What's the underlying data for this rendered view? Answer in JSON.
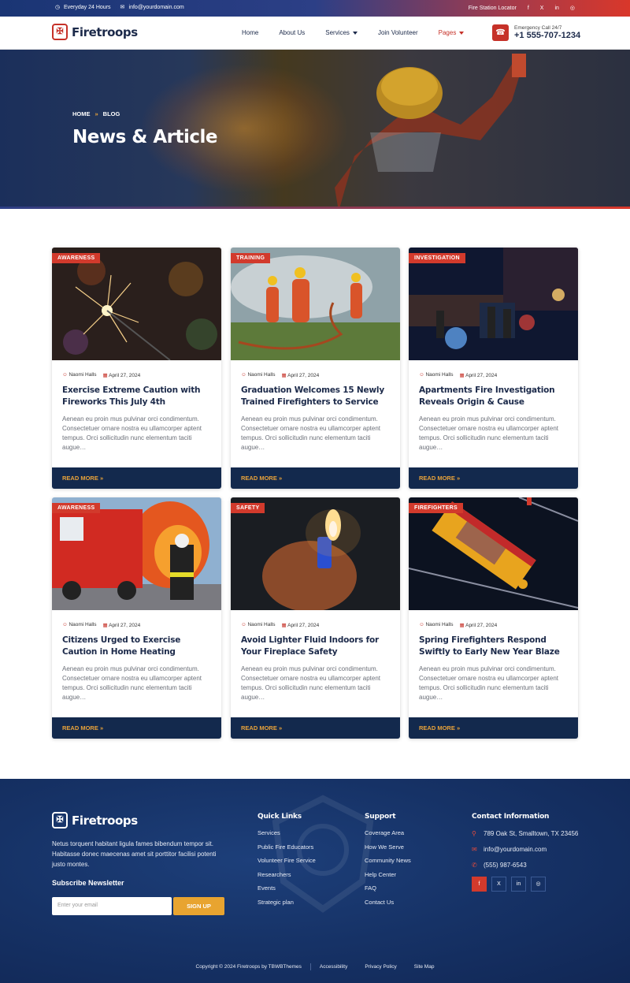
{
  "topbar": {
    "hours": "Everyday 24 Hours",
    "email": "info@yourdomain.com",
    "locator": "Fire Station Locator",
    "social": [
      "f",
      "X",
      "in",
      "ig"
    ]
  },
  "header": {
    "brand": "Firetroops",
    "nav": [
      "Home",
      "About Us",
      "Services",
      "Join Volunteer",
      "Pages"
    ],
    "emergency_label": "Emergency Call 24/7",
    "emergency_phone": "+1 555-707-1234"
  },
  "hero": {
    "breadcrumb": [
      "HOME",
      "BLOG"
    ],
    "title": "News & Article"
  },
  "posts": [
    {
      "tag": "AWARENESS",
      "author": "Naomi Halls",
      "date": "April 27, 2024",
      "title": "Exercise Extreme Caution with Fireworks This July 4th",
      "excerpt": "Aenean eu proin mus pulvinar orci condimentum. Consectetuer ornare nostra eu ullamcorper aptent tempus. Orci sollicitudin nunc elementum taciti augue…",
      "more": "READ MORE"
    },
    {
      "tag": "TRAINING",
      "author": "Naomi Halls",
      "date": "April 27, 2024",
      "title": "Graduation Welcomes 15 Newly Trained Firefighters to Service",
      "excerpt": "Aenean eu proin mus pulvinar orci condimentum. Consectetuer ornare nostra eu ullamcorper aptent tempus. Orci sollicitudin nunc elementum taciti augue…",
      "more": "READ MORE"
    },
    {
      "tag": "INVESTIGATION",
      "author": "Naomi Halls",
      "date": "April 27, 2024",
      "title": "Apartments Fire Investigation Reveals Origin & Cause",
      "excerpt": "Aenean eu proin mus pulvinar orci condimentum. Consectetuer ornare nostra eu ullamcorper aptent tempus. Orci sollicitudin nunc elementum taciti augue…",
      "more": "READ MORE"
    },
    {
      "tag": "AWARENESS",
      "author": "Naomi Halls",
      "date": "April 27, 2024",
      "title": "Citizens Urged to Exercise Caution in Home Heating",
      "excerpt": "Aenean eu proin mus pulvinar orci condimentum. Consectetuer ornare nostra eu ullamcorper aptent tempus. Orci sollicitudin nunc elementum taciti augue…",
      "more": "READ MORE"
    },
    {
      "tag": "SAFETY",
      "author": "Naomi Halls",
      "date": "April 27, 2024",
      "title": "Avoid Lighter Fluid Indoors for Your Fireplace Safety",
      "excerpt": "Aenean eu proin mus pulvinar orci condimentum. Consectetuer ornare nostra eu ullamcorper aptent tempus. Orci sollicitudin nunc elementum taciti augue…",
      "more": "READ MORE"
    },
    {
      "tag": "FIREFIGHTERS",
      "author": "Naomi Halls",
      "date": "April 27, 2024",
      "title": "Spring Firefighters Respond Swiftly to Early New Year Blaze",
      "excerpt": "Aenean eu proin mus pulvinar orci condimentum. Consectetuer ornare nostra eu ullamcorper aptent tempus. Orci sollicitudin nunc elementum taciti augue…",
      "more": "READ MORE"
    }
  ],
  "footer": {
    "brand": "Firetroops",
    "description": "Netus torquent habitant ligula fames bibendum tempor sit. Habitasse donec maecenas amet sit porttitor facilisi potenti justo montes.",
    "newsletter_title": "Subscribe Newsletter",
    "newsletter_placeholder": "Enter your email",
    "newsletter_button": "SIGN UP",
    "quick_links_title": "Quick Links",
    "quick_links": [
      "Services",
      "Public Fire Educators",
      "Volunteer Fire Service",
      "Researchers",
      "Events",
      "Strategic plan"
    ],
    "support_title": "Support",
    "support_links": [
      "Coverage Area",
      "How We Serve",
      "Community News",
      "Help Center",
      "FAQ",
      "Contact Us"
    ],
    "contact_title": "Contact Information",
    "address": "789 Oak St, Smalltown, TX 23456",
    "email": "info@yourdomain.com",
    "phone": "(555) 987-6543",
    "social": [
      "f",
      "X",
      "in",
      "ig"
    ],
    "copyright": "Copyright © 2024 Firetroops by TBWBThemes",
    "bottom_links": [
      "Accessibility",
      "Privacy Policy",
      "Site Map"
    ]
  },
  "colors": {
    "primary_red": "#d23a2c",
    "navy": "#13294d",
    "accent_gold": "#e9a33a"
  }
}
